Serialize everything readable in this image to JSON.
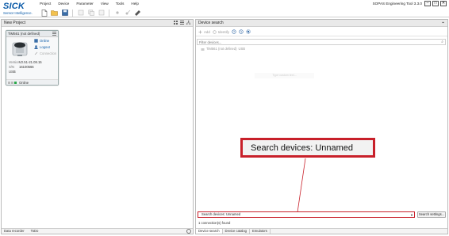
{
  "logo": {
    "brand": "SICK",
    "tagline": "Sensor Intelligence."
  },
  "menu": [
    "Project",
    "Device",
    "Parameter",
    "View",
    "Tools",
    "Help"
  ],
  "app_title": "SOPAS Engineering Tool 3.3.0",
  "window_controls": {
    "minimize": "–",
    "maximize": "□",
    "close": "✕"
  },
  "left_panel": {
    "title": "New Project",
    "card": {
      "title": "TiM561 (not defined)",
      "actions": {
        "online": "Online",
        "logout": "Logout",
        "connection": "Connection"
      },
      "info": [
        {
          "key": "Version",
          "value": "V2.51-21.08.15"
        },
        {
          "key": "S/N",
          "value": "16100566"
        },
        {
          "key": "",
          "value": "USB"
        }
      ],
      "status": "Online"
    },
    "tabs": [
      "Data recorder",
      "ToDo"
    ]
  },
  "right_panel": {
    "title": "Device search",
    "toolbar": {
      "add": "Add",
      "identify": "Identify"
    },
    "filter_placeholder": "Filter devices...",
    "found_device": "TiM561 (not defined)",
    "found_interface": "USB",
    "hint": "Type custom text...",
    "callout": "Search devices: Unnamed",
    "search_select": "Search devices: Unnamed",
    "search_settings": "Search settings...",
    "connection_status": "1 connection(s) found",
    "tabs": [
      "Device search",
      "Device catalog",
      "Emulators"
    ]
  },
  "colors": {
    "brand": "#0a5aa8",
    "callout_border": "#c8202a",
    "status_online": "#2aa84a"
  }
}
